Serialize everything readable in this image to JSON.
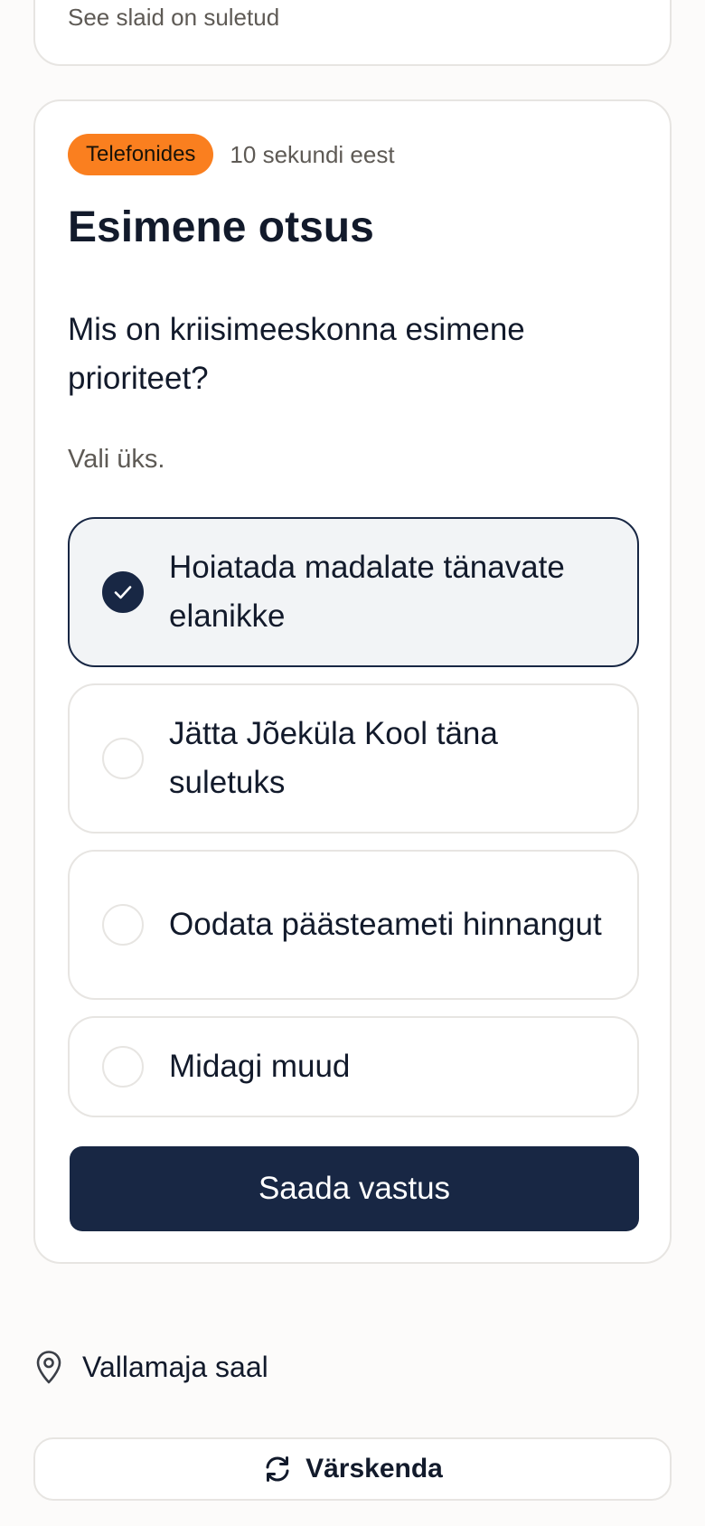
{
  "previous_card": {
    "status_text": "See slaid on suletud"
  },
  "question_card": {
    "badge": "Telefonides",
    "badge_color": "#fa7f1f",
    "time_ago": "10 sekundi eest",
    "title": "Esimene otsus",
    "question": "Mis on kriisimeeskonna esimene prioriteet?",
    "hint": "Vali üks.",
    "options": [
      {
        "label": "Hoiatada madalate tänavate elanikke",
        "selected": true
      },
      {
        "label": "Jätta Jõeküla Kool täna suletuks",
        "selected": false
      },
      {
        "label": "Oodata päästeameti hinnangut",
        "selected": false
      },
      {
        "label": "Midagi muud",
        "selected": false
      }
    ],
    "submit_label": "Saada vastus"
  },
  "location": {
    "icon": "map-pin-icon",
    "label": "Vallamaja saal"
  },
  "refresh": {
    "icon": "refresh-icon",
    "label": "Värskenda"
  },
  "colors": {
    "primary": "#182744",
    "accent": "#fa7f1f",
    "muted_text": "#5e5a55",
    "border": "#e7e5e2",
    "background": "#fcfbfa"
  }
}
